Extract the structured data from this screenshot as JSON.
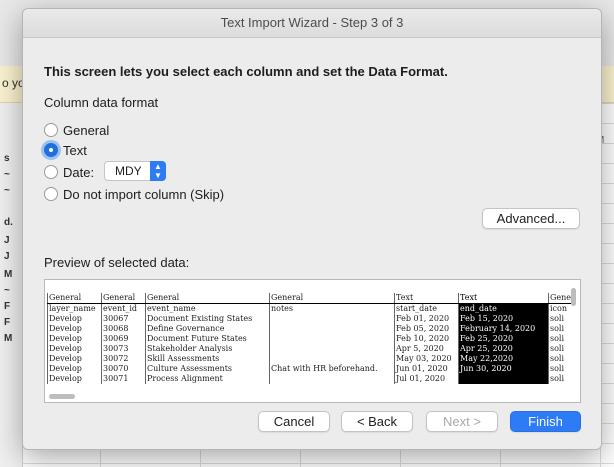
{
  "background": {
    "notice_text": "o yo",
    "row_labels": [
      "s",
      "~",
      "~",
      "d.",
      "J",
      "J",
      "M",
      "~",
      "F",
      "F",
      "~",
      "M"
    ],
    "right_label": "M"
  },
  "dialog": {
    "title": "Text Import Wizard - Step 3 of 3",
    "intro": "This screen lets you select each column and set the Data Format.",
    "column_format_label": "Column data format",
    "options": [
      {
        "label": "General",
        "selected": false
      },
      {
        "label": "Text",
        "selected": true
      },
      {
        "label": "Date:",
        "selected": false
      },
      {
        "label": "Do not import column (Skip)",
        "selected": false
      }
    ],
    "date_format": "MDY",
    "advanced_label": "Advanced...",
    "preview_label": "Preview of selected data:",
    "preview": {
      "header": [
        "General",
        "General",
        "General",
        "General",
        "Text",
        "Text",
        "Gene"
      ],
      "rows": [
        [
          "layer_name",
          "event_id",
          "event_name",
          "notes",
          "start_date",
          "end_date",
          "icon"
        ],
        [
          "Develop",
          "30067",
          "Document Existing States",
          "",
          "Feb 01, 2020",
          "Feb 15, 2020",
          "soli"
        ],
        [
          "Develop",
          "30068",
          "Define Governance",
          "",
          "Feb 05, 2020",
          "February 14, 2020",
          "soli"
        ],
        [
          "Develop",
          "30069",
          "Document Future States",
          "",
          "Feb 10, 2020",
          "Feb 25, 2020",
          "soli"
        ],
        [
          "Develop",
          "30073",
          "Stakeholder Analysis",
          "",
          "Apr 5, 2020",
          "Apr 25, 2020",
          "soli"
        ],
        [
          "Develop",
          "30072",
          "Skill Assessments",
          "",
          "May 03, 2020",
          "May 22,2020",
          "soli"
        ],
        [
          "Develop",
          "30070",
          "Culture Assessments",
          "Chat with HR beforehand.",
          "Jun 01, 2020",
          "Jun 30, 2020",
          "soli"
        ],
        [
          "Develop",
          "30071",
          "Process Alignment",
          "",
          "Jul 01, 2020",
          "",
          "soli"
        ]
      ]
    },
    "buttons": {
      "cancel": "Cancel",
      "back": "< Back",
      "next": "Next >",
      "finish": "Finish"
    },
    "accent_color": "#2d7cf6"
  }
}
